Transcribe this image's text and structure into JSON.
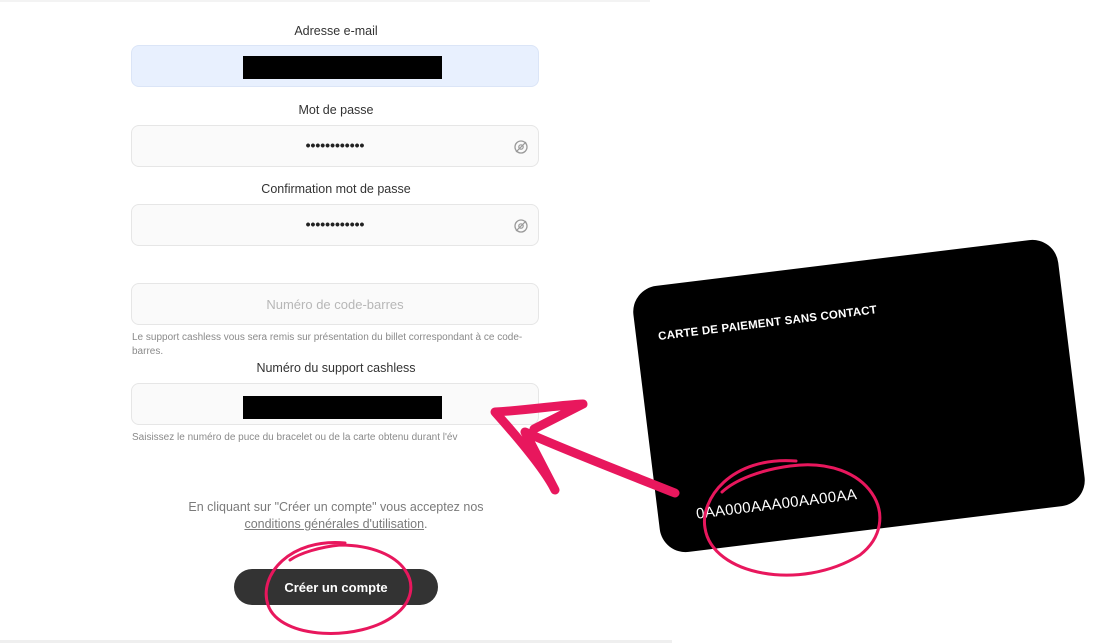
{
  "form": {
    "email_label": "Adresse e-mail",
    "password_label": "Mot de passe",
    "password_value": "••••••••••••",
    "confirm_label": "Confirmation mot de passe",
    "confirm_value": "••••••••••••",
    "barcode_placeholder": "Numéro de code-barres",
    "barcode_help": "Le support cashless vous sera remis sur présentation du billet correspondant à ce code-barres.",
    "cashless_label": "Numéro du support cashless",
    "cashless_help": "Saisissez le numéro de puce du bracelet ou de la carte obtenu durant l'év",
    "terms_prefix": "En cliquant sur \"Créer un compte\" vous acceptez nos",
    "terms_link": "conditions générales d'utilisation",
    "terms_suffix": ".",
    "submit_label": "Créer un compte"
  },
  "card": {
    "title": "CARTE DE PAIEMENT SANS CONTACT",
    "number": "0AA000AAA00AA00AA"
  },
  "icons": {
    "password_toggle": "eye-icon",
    "annotation_arrow": "arrow-icon"
  },
  "colors": {
    "accent": "#e8175d",
    "button": "#333333",
    "autofill": "#e8f0fe"
  }
}
